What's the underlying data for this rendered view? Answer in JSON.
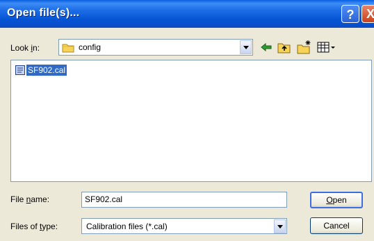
{
  "window": {
    "title": "Open file(s)..."
  },
  "title_buttons": {
    "help": "?",
    "close": "X"
  },
  "lookin": {
    "label_pre": "Look ",
    "label_key": "i",
    "label_post": "n:",
    "value": "config"
  },
  "toolbar": {
    "back_icon": "back-arrow-icon",
    "up_icon": "up-folder-icon",
    "new_icon": "new-folder-icon",
    "view_icon": "view-menu-icon"
  },
  "files": [
    {
      "name": "SF902.cal",
      "icon": "file-icon",
      "selected": true
    }
  ],
  "filename": {
    "label_pre": "File ",
    "label_key": "n",
    "label_post": "ame:",
    "value": "SF902.cal"
  },
  "filetype": {
    "label_pre": "Files of ",
    "label_key": "t",
    "label_post": "ype:",
    "value": "Calibration files (*.cal)"
  },
  "buttons": {
    "open_key": "O",
    "open_rest": "pen",
    "cancel": "Cancel"
  },
  "colors": {
    "titlebar": "#0a5fe0",
    "selection": "#316ac5",
    "face": "#ece9d8"
  }
}
